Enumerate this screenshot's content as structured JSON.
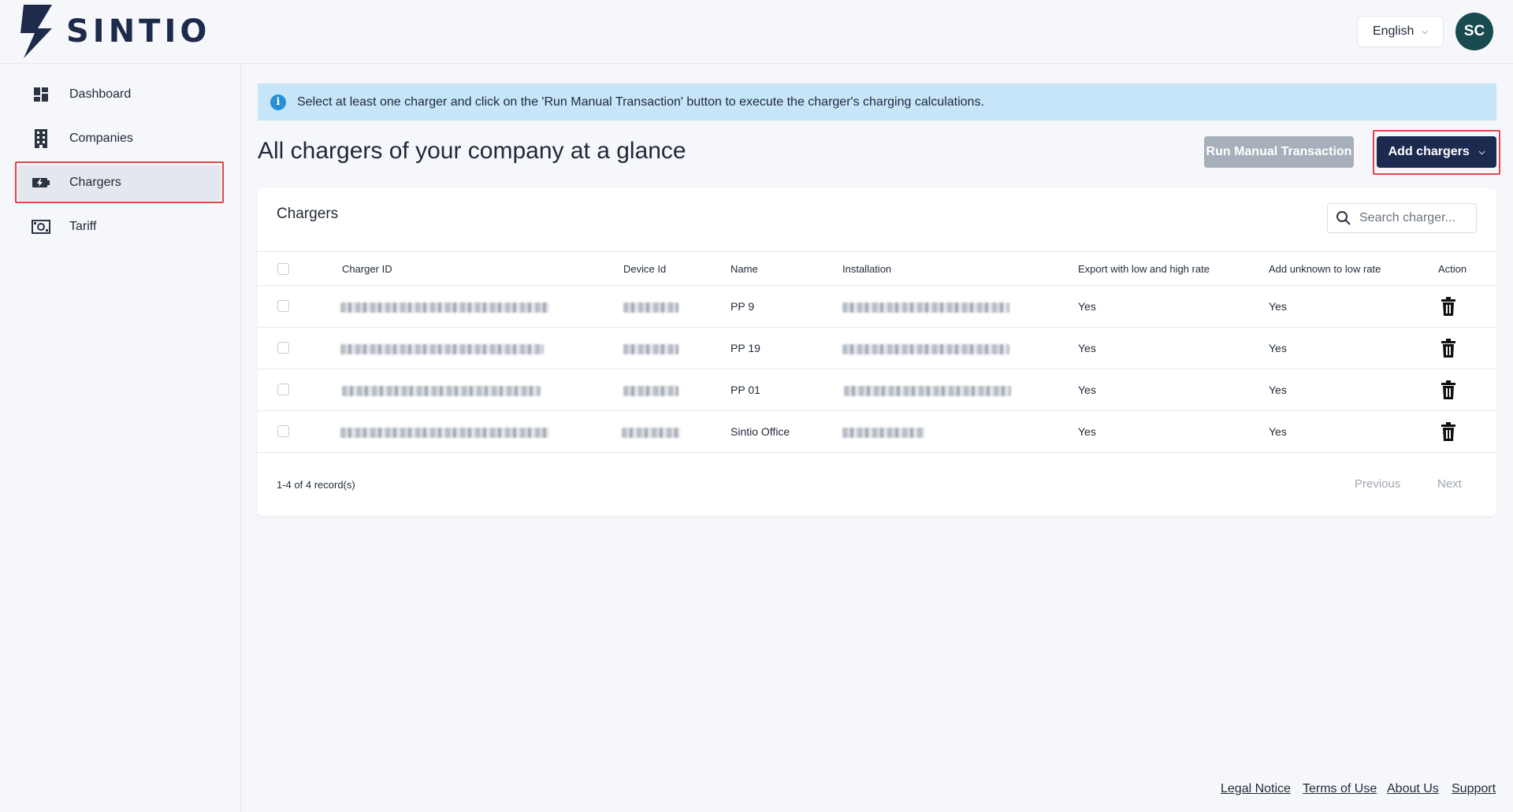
{
  "header": {
    "brand": "SINTIO",
    "language": "English",
    "avatar_initials": "SC"
  },
  "sidebar": {
    "items": [
      {
        "label": "Dashboard",
        "icon": "dashboard-icon"
      },
      {
        "label": "Companies",
        "icon": "building-icon"
      },
      {
        "label": "Chargers",
        "icon": "battery-charging-icon",
        "active": true
      },
      {
        "label": "Tariff",
        "icon": "money-icon"
      }
    ]
  },
  "banner": {
    "text": "Select at least one charger and click on the 'Run Manual Transaction' button to execute the charger's charging calculations."
  },
  "main": {
    "title": "All chargers of your company at a glance",
    "run_button": "Run Manual Transaction",
    "add_button": "Add chargers"
  },
  "card": {
    "title": "Chargers",
    "search_placeholder": "Search charger...",
    "columns": [
      "Charger ID",
      "Device Id",
      "Name",
      "Installation",
      "Export with low and high rate",
      "Add unknown to low rate",
      "Action"
    ],
    "rows": [
      {
        "name": "PP 9",
        "export": "Yes",
        "unknown": "Yes"
      },
      {
        "name": "PP 19",
        "export": "Yes",
        "unknown": "Yes"
      },
      {
        "name": "PP 01",
        "export": "Yes",
        "unknown": "Yes"
      },
      {
        "name": "Sintio Office",
        "export": "Yes",
        "unknown": "Yes"
      }
    ],
    "records": "1-4 of 4 record(s)",
    "previous": "Previous",
    "next": "Next"
  },
  "footer": {
    "links": [
      "Legal Notice",
      "Terms of Use",
      "About Us",
      "Support"
    ]
  },
  "colors": {
    "brand": "#1e2a4a",
    "primary_button": "#1b2a4e",
    "disabled_button": "#a6afba",
    "banner_bg": "#c6e5f8",
    "highlight": "#e0454a",
    "avatar_bg": "#184a50"
  }
}
